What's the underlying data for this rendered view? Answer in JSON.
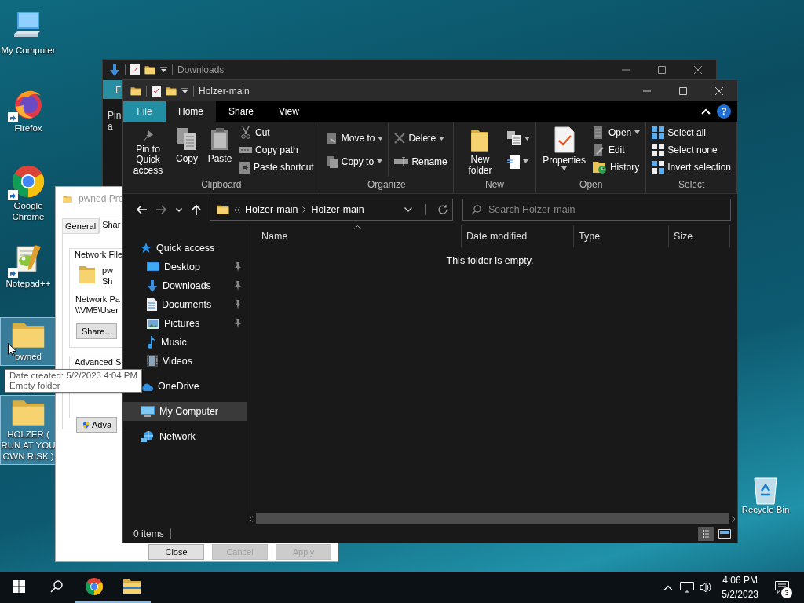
{
  "desktop_icons": [
    {
      "label": "My Computer",
      "kind": "computer",
      "shortcut": false,
      "selected": false
    },
    {
      "label": "Firefox",
      "kind": "firefox",
      "shortcut": true,
      "selected": false
    },
    {
      "label": "Google Chrome",
      "kind": "chrome",
      "shortcut": true,
      "selected": false
    },
    {
      "label": "Notepad++",
      "kind": "notepad",
      "shortcut": true,
      "selected": false
    },
    {
      "label": "pwned",
      "kind": "folder",
      "shortcut": false,
      "selected": true
    },
    {
      "label": "HOLZER ( RUN AT YOU OWN RISK )",
      "kind": "folder",
      "shortcut": false,
      "selected": true
    }
  ],
  "recycle_bin": {
    "label": "Recycle Bin"
  },
  "back_window": {
    "title": "Downloads",
    "tab": "F",
    "button_lines": [
      "Pin",
      "a"
    ]
  },
  "properties_dialog": {
    "title": "pwned Pro",
    "tabs": [
      {
        "label": "General",
        "selected": false
      },
      {
        "label": "Shar",
        "selected": true
      }
    ],
    "group_title": "Network File",
    "item_lines": [
      "pw",
      "Sh"
    ],
    "path_label": "Network Pa",
    "path": "\\\\VM5\\User",
    "share_button": "Share…",
    "advanced_title": "Advanced S",
    "advanced_button": "Adva",
    "buttons": [
      {
        "label": "Close",
        "disabled": false
      },
      {
        "label": "Cancel",
        "disabled": true
      },
      {
        "label": "Apply",
        "disabled": true
      }
    ]
  },
  "explorer": {
    "title": "Holzer-main",
    "help": "?",
    "ribbon_tabs": [
      {
        "label": "File",
        "kind": "menu",
        "selected": false
      },
      {
        "label": "Home",
        "kind": "tab",
        "selected": true
      },
      {
        "label": "Share",
        "kind": "tab",
        "selected": false
      },
      {
        "label": "View",
        "kind": "tab",
        "selected": false
      }
    ],
    "ribbon_groups": [
      {
        "label": "Clipboard",
        "columns": [
          [
            {
              "label": "Pin to Quick access",
              "kind": "large",
              "dropdown": false
            }
          ],
          [
            {
              "label": "Copy",
              "kind": "large",
              "dropdown": false
            }
          ],
          [
            {
              "label": "Paste",
              "kind": "large",
              "dropdown": false
            }
          ],
          [
            {
              "label": "Cut",
              "kind": "small",
              "dropdown": false
            },
            {
              "label": "Copy path",
              "kind": "small",
              "dropdown": false
            },
            {
              "label": "Paste shortcut",
              "kind": "small",
              "dropdown": false
            }
          ]
        ]
      },
      {
        "label": "Organize",
        "columns": [
          [
            {
              "label": "Move to",
              "kind": "small",
              "dropdown": true
            },
            {
              "label": "Copy to",
              "kind": "small",
              "dropdown": true
            }
          ],
          [
            {
              "label": "Delete",
              "kind": "small",
              "dropdown": true
            },
            {
              "label": "Rename",
              "kind": "small",
              "dropdown": false
            }
          ]
        ]
      },
      {
        "label": "New",
        "columns": [
          [
            {
              "label": "New folder",
              "kind": "large",
              "dropdown": false
            }
          ],
          [
            {
              "kind": "icon",
              "dropdown": true
            },
            {
              "kind": "icon",
              "dropdown": true
            }
          ]
        ]
      },
      {
        "label": "Open",
        "columns": [
          [
            {
              "label": "Properties",
              "kind": "large",
              "dropdown": true
            }
          ],
          [
            {
              "label": "Open",
              "kind": "small",
              "dropdown": true
            },
            {
              "label": "Edit",
              "kind": "small",
              "dropdown": false
            },
            {
              "label": "History",
              "kind": "small",
              "dropdown": false
            }
          ]
        ]
      },
      {
        "label": "Select",
        "columns": [
          [
            {
              "label": "Select all",
              "kind": "small",
              "dropdown": false
            },
            {
              "label": "Select none",
              "kind": "small",
              "dropdown": false
            },
            {
              "label": "Invert selection",
              "kind": "small",
              "dropdown": false
            }
          ]
        ]
      }
    ],
    "forward_disabled": true,
    "address": [
      "Holzer-main",
      "Holzer-main"
    ],
    "search": {
      "placeholder": "Search Holzer-main"
    },
    "sidebar": [
      {
        "label": "Quick access",
        "kind": "star",
        "selected": false,
        "children": [
          {
            "label": "Desktop",
            "kind": "desktop",
            "pinned": true,
            "selected": false
          },
          {
            "label": "Downloads",
            "kind": "downloads",
            "pinned": true,
            "selected": false
          },
          {
            "label": "Documents",
            "kind": "documents",
            "pinned": true,
            "selected": false
          },
          {
            "label": "Pictures",
            "kind": "pictures",
            "pinned": true,
            "selected": false
          },
          {
            "label": "Music",
            "kind": "music",
            "pinned": false,
            "selected": false
          },
          {
            "label": "Videos",
            "kind": "videos",
            "pinned": false,
            "selected": false
          }
        ]
      },
      {
        "label": "OneDrive",
        "kind": "cloud",
        "selected": false
      },
      {
        "label": "My Computer",
        "kind": "computer",
        "selected": true
      },
      {
        "label": "Network",
        "kind": "network",
        "selected": false
      }
    ],
    "columns": [
      {
        "label": "Name",
        "sorted": true
      },
      {
        "label": "Date modified",
        "sorted": false
      },
      {
        "label": "Type",
        "sorted": false
      },
      {
        "label": "Size",
        "sorted": false
      }
    ],
    "empty_message": "This folder is empty.",
    "status": "0 items",
    "views": [
      {
        "kind": "details",
        "selected": true
      },
      {
        "kind": "tiles",
        "selected": false
      }
    ]
  },
  "tooltip": {
    "lines": [
      "Date created: 5/2/2023 4:04 PM",
      "Empty folder"
    ]
  },
  "taskbar": {
    "apps": [
      {
        "kind": "chrome",
        "running": true
      },
      {
        "kind": "explorer",
        "running": true
      }
    ],
    "time": "4:06 PM",
    "date": "5/2/2023",
    "notifications": "3"
  }
}
